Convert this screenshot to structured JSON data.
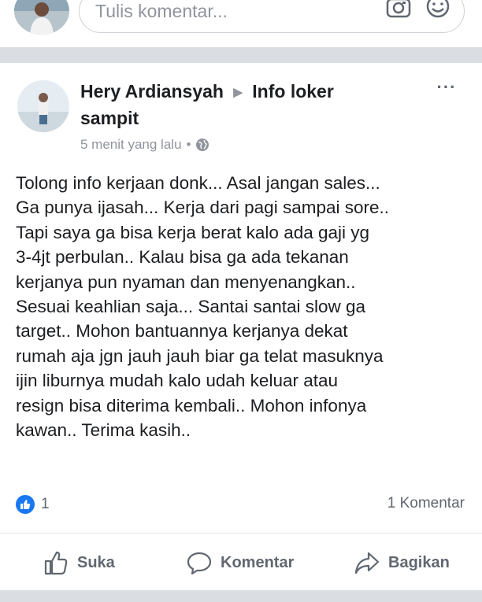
{
  "composer": {
    "placeholder": "Tulis komentar...",
    "icons": [
      "camera-icon",
      "smiley-icon"
    ]
  },
  "post": {
    "author": "Hery Ardiansyah",
    "arrow": "▶",
    "group": "Info loker sampit",
    "time": "5 menit yang lalu",
    "separator": "•",
    "privacy_icon": "globe-icon",
    "more_label": "···",
    "body_lines": [
      "Tolong info kerjaan donk...  Asal jangan sales...",
      "Ga punya ijasah...  Kerja dari pagi sampai sore..",
      "Tapi saya ga bisa kerja berat kalo ada gaji yg",
      "3-4jt perbulan..  Kalau bisa ga ada tekanan",
      "kerjanya pun nyaman dan menyenangkan..",
      "Sesuai keahlian saja...  Santai santai slow ga",
      "target..  Mohon bantuannya kerjanya dekat",
      "rumah aja jgn jauh jauh biar ga telat masuknya",
      "ijin liburnya mudah kalo udah keluar atau",
      "resign bisa diterima kembali..  Mohon infonya",
      "kawan..  Terima kasih.."
    ],
    "like_count": "1",
    "comment_count": "1 Komentar"
  },
  "actions": {
    "like": "Suka",
    "comment": "Komentar",
    "share": "Bagikan"
  },
  "colors": {
    "accent": "#1877f2",
    "secondary_text": "#606770",
    "meta_text": "#90949c",
    "background": "#dadde1"
  }
}
